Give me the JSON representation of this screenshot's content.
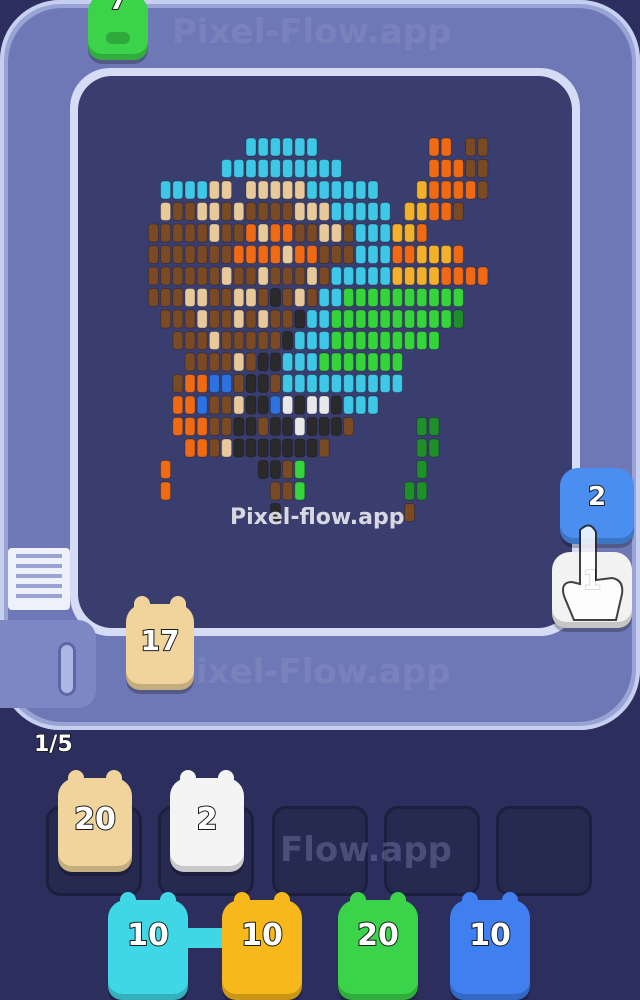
{
  "brand": {
    "watermark_center": "Pixel-flow.app",
    "watermark_bottom": "ixel-Flow.app",
    "watermark_top": "Pixel-Flow.app",
    "watermark_slots": "Flow.app"
  },
  "conveyor": {
    "top_creature_count": "7",
    "top_creature_color": "#3bd34a",
    "queue_creature_count": "17",
    "queue_creature_color": "#f0d49c",
    "progress": "1/5"
  },
  "hint": {
    "upper_count": "2",
    "upper_color": "#4a8ff0",
    "lower_count": "1",
    "lower_color": "#f2f2f2"
  },
  "slots": {
    "filled": [
      {
        "count": "20",
        "color": "#f0d49c"
      },
      {
        "count": "2",
        "color": "#f4f4f4"
      }
    ],
    "empty_count": 3
  },
  "bottom_row": [
    {
      "count": "10",
      "color": "#3fd7e6"
    },
    {
      "count": "10",
      "color": "#f6b81a"
    },
    {
      "count": "20",
      "color": "#3bd34a"
    },
    {
      "count": "10",
      "color": "#3f7ff0"
    }
  ],
  "colors": {
    "background": "#2c2f5e",
    "track": "#9aa4d4",
    "board": "#3a3e6e"
  }
}
